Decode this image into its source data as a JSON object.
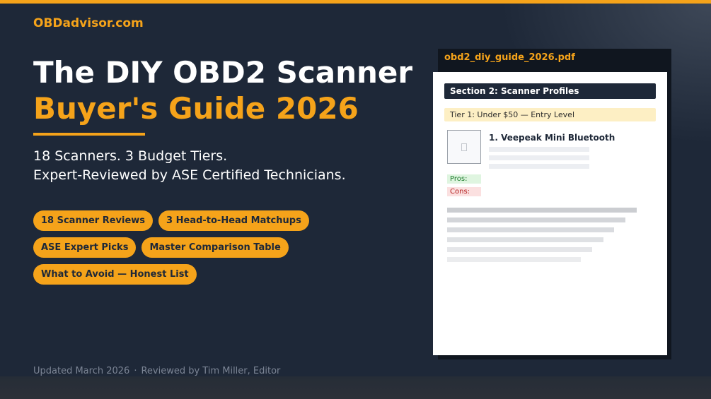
{
  "brand": "OBDadvisor.com",
  "headline": {
    "line1": "The DIY OBD2 Scanner",
    "line2": "Buyer's Guide 2026"
  },
  "subtitle": {
    "line1": "18 Scanners. 3 Budget Tiers.",
    "line2": "Expert-Reviewed by ASE Certified Technicians."
  },
  "pills": {
    "row1": [
      "18 Scanner Reviews",
      "3 Head-to-Head Matchups"
    ],
    "row2": [
      "ASE Expert Picks",
      "Master Comparison Table"
    ],
    "row3": [
      "What to Avoid — Honest List"
    ]
  },
  "footer": {
    "updated": "Updated March 2026",
    "separator": "·",
    "reviewed": "Reviewed by Tim Miller, Editor"
  },
  "document": {
    "filename": "obd2_diy_guide_2026.pdf",
    "section": "Section 2: Scanner Profiles",
    "tier": "Tier 1: Under $50 — Entry Level",
    "product": "1. Veepeak Mini Bluetooth",
    "pros_label": "Pros:",
    "cons_label": "Cons:",
    "thumbnail_icon": "image-placeholder-icon"
  },
  "colors": {
    "accent": "#f5a31a",
    "background": "#1e2838",
    "pros_text": "#1b7a2a",
    "cons_text": "#b32020"
  }
}
